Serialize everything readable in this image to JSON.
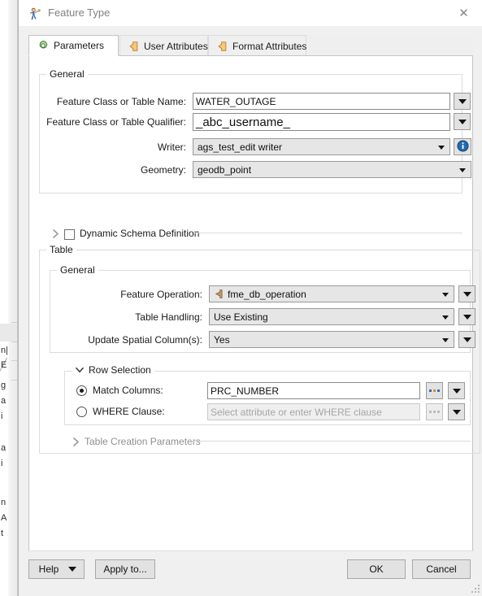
{
  "window": {
    "title": "Feature Type",
    "icon": "fme-feature-type-icon",
    "close_label": "✕"
  },
  "tabs": [
    {
      "label": "Parameters",
      "icon": "green-gear-icon",
      "active": true
    },
    {
      "label": "User Attributes",
      "icon": "orange-tag-icon",
      "active": false
    },
    {
      "label": "Format Attributes",
      "icon": "orange-tag-icon",
      "active": false
    }
  ],
  "general": {
    "group_label": "General",
    "fields": {
      "feature_class_name": {
        "label": "Feature Class or Table Name:",
        "value": "WATER_OUTAGE",
        "placeholder": ""
      },
      "feature_class_qualifier": {
        "label": "Feature Class or Table Qualifier:",
        "value": "_abc_username_",
        "placeholder": ""
      },
      "writer": {
        "label": "Writer:",
        "value": "ags_test_edit writer",
        "info_icon": "info-circle-icon"
      },
      "geometry": {
        "label": "Geometry:",
        "value": "geodb_point"
      }
    },
    "dynamic_schema": {
      "label": "Dynamic Schema Definition",
      "checked": false,
      "expanded": false,
      "chevron": "chevron-right-icon"
    }
  },
  "table": {
    "group_label": "Table",
    "general_group_label": "General",
    "fields": {
      "feature_operation": {
        "label": "Feature Operation:",
        "value": "fme_db_operation",
        "value_icon": "attribute-tag-icon"
      },
      "table_handling": {
        "label": "Table Handling:",
        "value": "Use Existing"
      },
      "update_spatial_columns": {
        "label": "Update Spatial Column(s):",
        "value": "Yes"
      }
    },
    "row_selection": {
      "group_label": "Row Selection",
      "expanded": true,
      "chevron": "chevron-down-icon",
      "match_columns": {
        "label": "Match Columns:",
        "selected": true,
        "value": "PRC_NUMBER",
        "placeholder": "",
        "browse_label": "...",
        "enabled": true
      },
      "where_clause": {
        "label": "WHERE Clause:",
        "selected": false,
        "value": "",
        "placeholder": "Select attribute or enter WHERE clause",
        "browse_label": "...",
        "enabled": false
      }
    },
    "table_creation_parameters": {
      "label": "Table Creation Parameters",
      "expanded": false,
      "chevron": "chevron-right-icon"
    }
  },
  "footer": {
    "help_label": "Help",
    "apply_to_label": "Apply to...",
    "ok_label": "OK",
    "cancel_label": "Cancel"
  },
  "colors": {
    "dialog_bg": "#f0f0f0",
    "content_bg": "#ffffff",
    "accent_info": "#1f6bb0",
    "tab_icon_green": "#4f9a40",
    "tab_icon_orange": "#e8a33d",
    "attr_tag": "#c49a6c"
  },
  "background": {
    "fragments": [
      "n|",
      "E",
      "g",
      "a",
      "i",
      "a",
      "i",
      "n",
      "A",
      "t"
    ]
  }
}
